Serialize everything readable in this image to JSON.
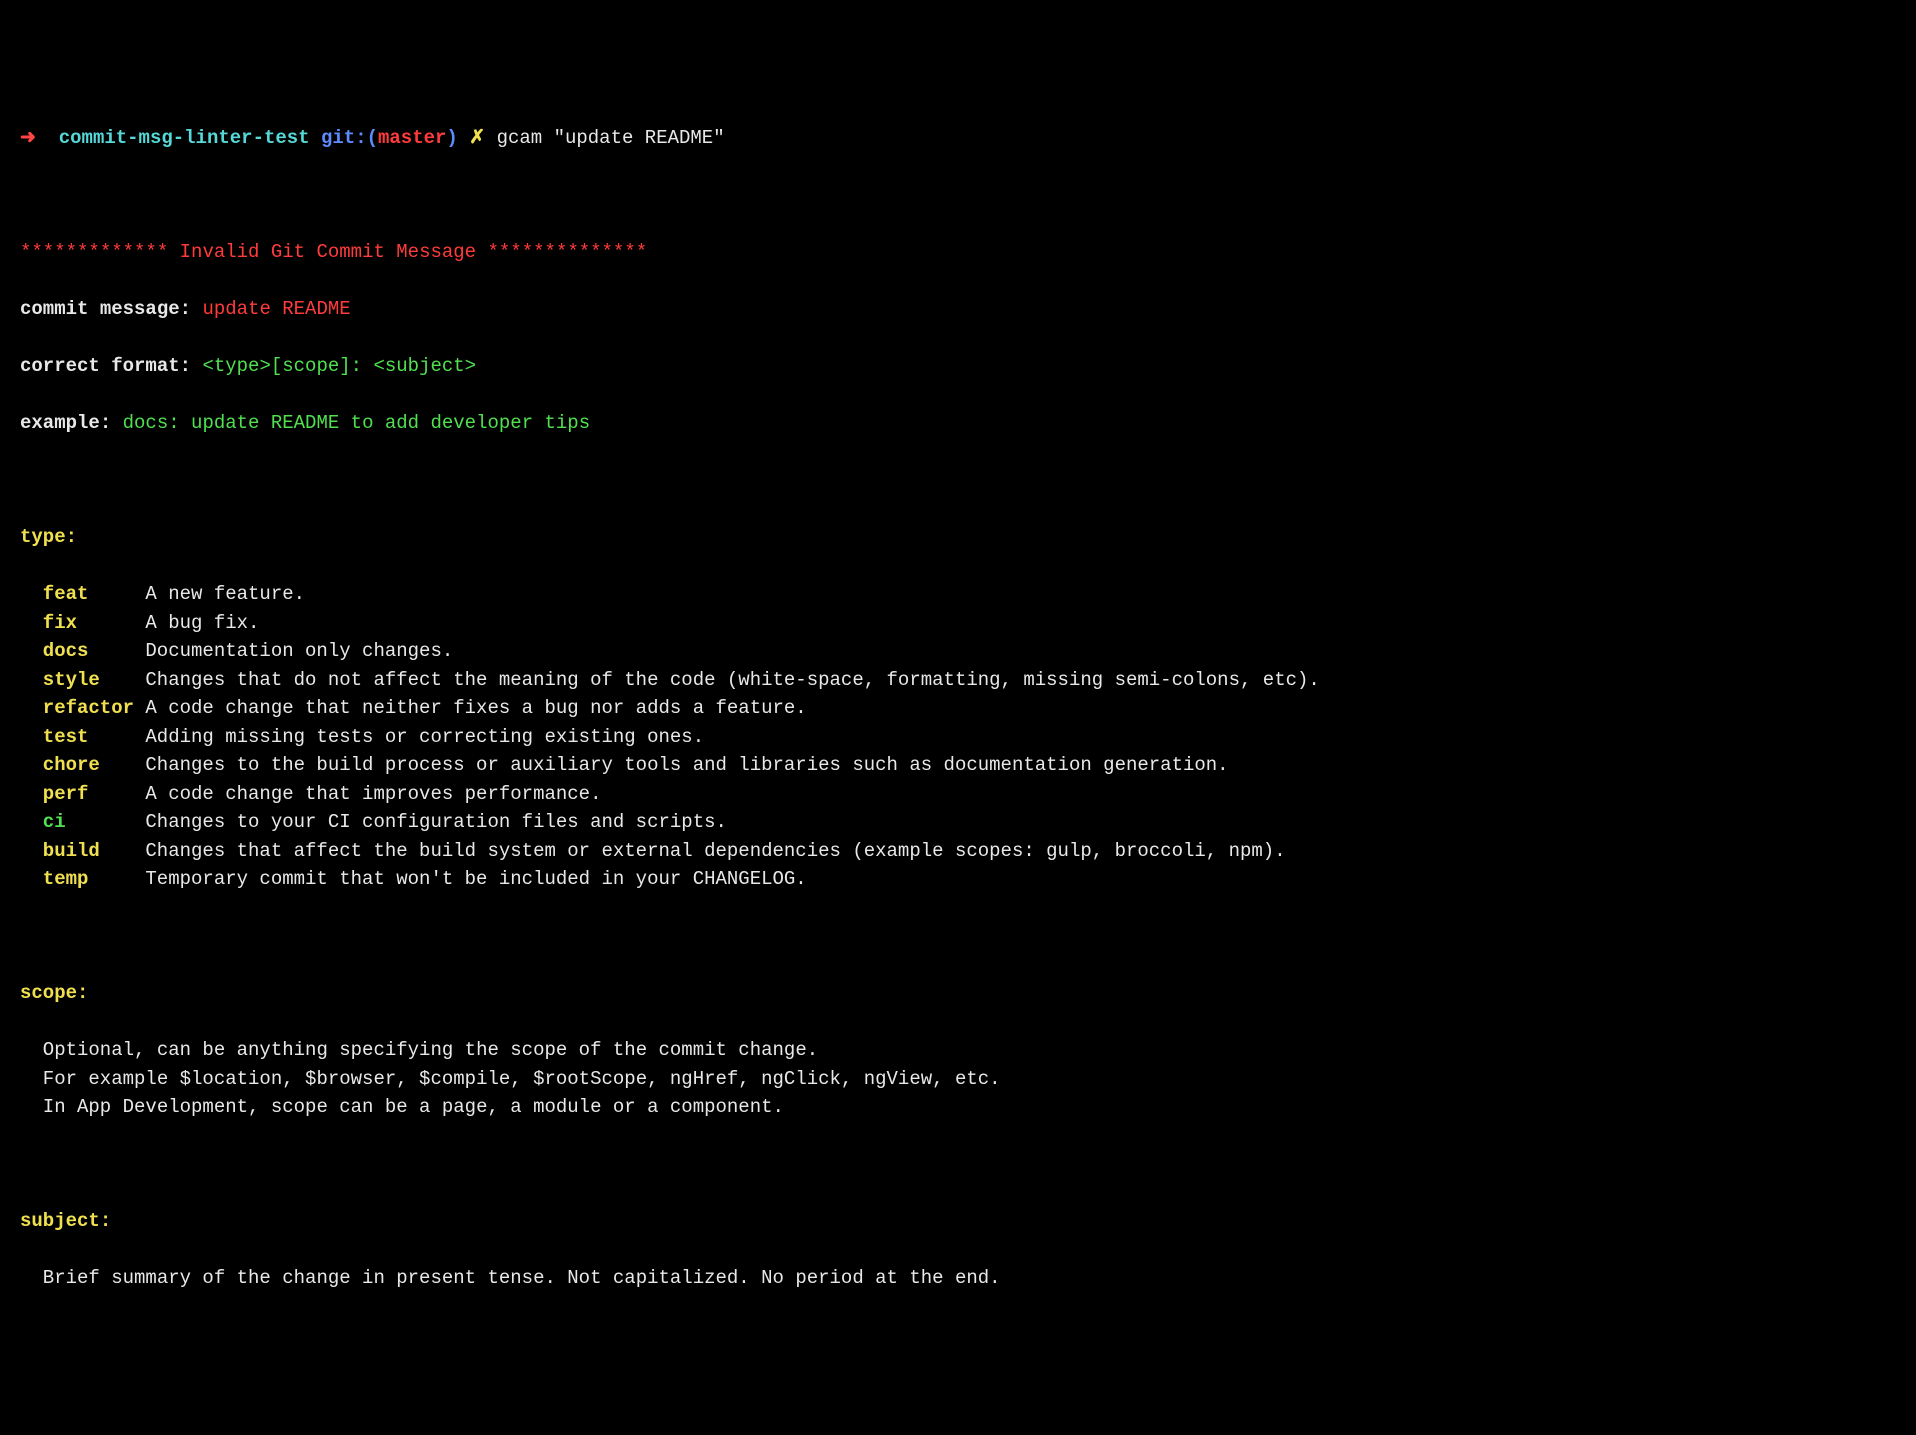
{
  "prompt": {
    "arrow": "➜",
    "dir": "commit-msg-linter-test",
    "gitprefix": "git:(",
    "branch": "master",
    "gitsuffix": ")",
    "dirty": "✗",
    "command": "gcam \"update README\""
  },
  "banner": {
    "stars_left": "*************",
    "title": " Invalid Git Commit Message ",
    "stars_right": "**************"
  },
  "info": {
    "commit_label": "commit message:",
    "commit_value": "update README",
    "format_label": "correct format:",
    "format_value": "<type>[scope]: <subject>",
    "example_label": "example:",
    "example_value": "docs: update README to add developer tips"
  },
  "type_header": "type:",
  "types": [
    {
      "name": "feat",
      "desc": "A new feature.",
      "color": "yellow"
    },
    {
      "name": "fix",
      "desc": "A bug fix.",
      "color": "yellow"
    },
    {
      "name": "docs",
      "desc": "Documentation only changes.",
      "color": "yellow"
    },
    {
      "name": "style",
      "desc": "Changes that do not affect the meaning of the code (white-space, formatting, missing semi-colons, etc).",
      "color": "yellow"
    },
    {
      "name": "refactor",
      "desc": "A code change that neither fixes a bug nor adds a feature.",
      "color": "yellow"
    },
    {
      "name": "test",
      "desc": "Adding missing tests or correcting existing ones.",
      "color": "yellow"
    },
    {
      "name": "chore",
      "desc": "Changes to the build process or auxiliary tools and libraries such as documentation generation.",
      "color": "yellow"
    },
    {
      "name": "perf",
      "desc": "A code change that improves performance.",
      "color": "yellow"
    },
    {
      "name": "ci",
      "desc": "Changes to your CI configuration files and scripts.",
      "color": "green"
    },
    {
      "name": "build",
      "desc": "Changes that affect the build system or external dependencies (example scopes: gulp, broccoli, npm).",
      "color": "yellow"
    },
    {
      "name": "temp",
      "desc": "Temporary commit that won't be included in your CHANGELOG.",
      "color": "yellow"
    }
  ],
  "scope_header": "scope:",
  "scope_lines": [
    "Optional, can be anything specifying the scope of the commit change.",
    "For example $location, $browser, $compile, $rootScope, ngHref, ngClick, ngView, etc.",
    "In App Development, scope can be a page, a module or a component."
  ],
  "subject_header": "subject:",
  "subject_lines": [
    "Brief summary of the change in present tense. Not capitalized. No period at the end."
  ]
}
